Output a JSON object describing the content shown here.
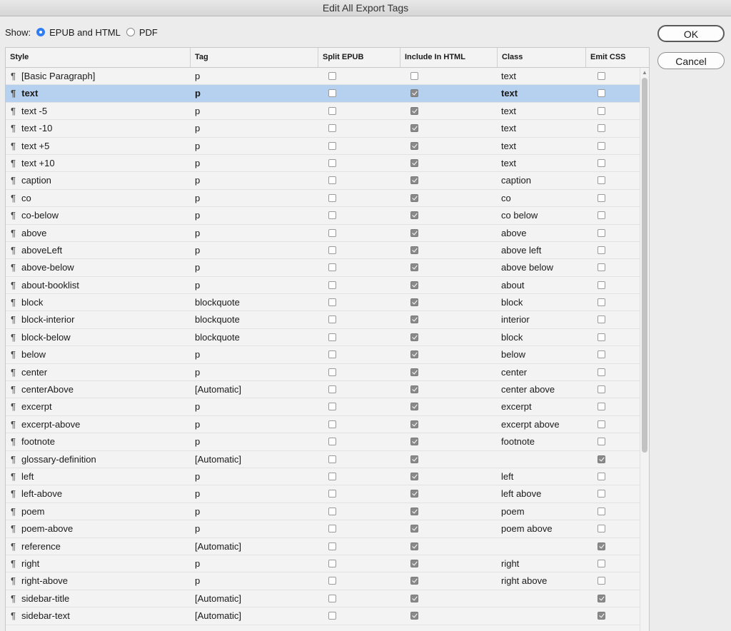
{
  "window": {
    "title": "Edit All Export Tags"
  },
  "show": {
    "label": "Show:",
    "options": [
      {
        "label": "EPUB and HTML",
        "selected": true
      },
      {
        "label": "PDF",
        "selected": false
      }
    ]
  },
  "buttons": {
    "ok": "OK",
    "cancel": "Cancel"
  },
  "table": {
    "headers": {
      "style": "Style",
      "tag": "Tag",
      "split": "Split EPUB",
      "include": "Include In HTML",
      "class": "Class",
      "css": "Emit CSS"
    },
    "paragraph_mark": "¶",
    "selected_row": 1,
    "rows": [
      {
        "style": "[Basic Paragraph]",
        "tag": "p",
        "split": false,
        "include": false,
        "class": "text",
        "css": false
      },
      {
        "style": "text",
        "tag": "p",
        "split": false,
        "include": true,
        "class": "text",
        "css": false
      },
      {
        "style": "text -5",
        "tag": "p",
        "split": false,
        "include": true,
        "class": "text",
        "css": false
      },
      {
        "style": "text -10",
        "tag": "p",
        "split": false,
        "include": true,
        "class": "text",
        "css": false
      },
      {
        "style": "text +5",
        "tag": "p",
        "split": false,
        "include": true,
        "class": "text",
        "css": false
      },
      {
        "style": "text +10",
        "tag": "p",
        "split": false,
        "include": true,
        "class": "text",
        "css": false
      },
      {
        "style": "caption",
        "tag": "p",
        "split": false,
        "include": true,
        "class": "caption",
        "css": false
      },
      {
        "style": "co",
        "tag": "p",
        "split": false,
        "include": true,
        "class": "co",
        "css": false
      },
      {
        "style": "co-below",
        "tag": "p",
        "split": false,
        "include": true,
        "class": "co below",
        "css": false
      },
      {
        "style": "above",
        "tag": "p",
        "split": false,
        "include": true,
        "class": "above",
        "css": false
      },
      {
        "style": "aboveLeft",
        "tag": "p",
        "split": false,
        "include": true,
        "class": "above left",
        "css": false
      },
      {
        "style": "above-below",
        "tag": "p",
        "split": false,
        "include": true,
        "class": "above below",
        "css": false
      },
      {
        "style": "about-booklist",
        "tag": "p",
        "split": false,
        "include": true,
        "class": "about",
        "css": false
      },
      {
        "style": "block",
        "tag": "blockquote",
        "split": false,
        "include": true,
        "class": "block",
        "css": false
      },
      {
        "style": "block-interior",
        "tag": "blockquote",
        "split": false,
        "include": true,
        "class": "interior",
        "css": false
      },
      {
        "style": "block-below",
        "tag": "blockquote",
        "split": false,
        "include": true,
        "class": "block",
        "css": false
      },
      {
        "style": "below",
        "tag": "p",
        "split": false,
        "include": true,
        "class": "below",
        "css": false
      },
      {
        "style": "center",
        "tag": "p",
        "split": false,
        "include": true,
        "class": "center",
        "css": false
      },
      {
        "style": "centerAbove",
        "tag": "[Automatic]",
        "split": false,
        "include": true,
        "class": "center above",
        "css": false
      },
      {
        "style": "excerpt",
        "tag": "p",
        "split": false,
        "include": true,
        "class": "excerpt",
        "css": false
      },
      {
        "style": "excerpt-above",
        "tag": "p",
        "split": false,
        "include": true,
        "class": "excerpt above",
        "css": false
      },
      {
        "style": "footnote",
        "tag": "p",
        "split": false,
        "include": true,
        "class": "footnote",
        "css": false
      },
      {
        "style": "glossary-definition",
        "tag": "[Automatic]",
        "split": false,
        "include": true,
        "class": "",
        "css": true
      },
      {
        "style": "left",
        "tag": "p",
        "split": false,
        "include": true,
        "class": "left",
        "css": false
      },
      {
        "style": "left-above",
        "tag": "p",
        "split": false,
        "include": true,
        "class": "left above",
        "css": false
      },
      {
        "style": "poem",
        "tag": "p",
        "split": false,
        "include": true,
        "class": "poem",
        "css": false
      },
      {
        "style": "poem-above",
        "tag": "p",
        "split": false,
        "include": true,
        "class": "poem above",
        "css": false
      },
      {
        "style": "reference",
        "tag": "[Automatic]",
        "split": false,
        "include": true,
        "class": "",
        "css": true
      },
      {
        "style": "right",
        "tag": "p",
        "split": false,
        "include": true,
        "class": "right",
        "css": false
      },
      {
        "style": "right-above",
        "tag": "p",
        "split": false,
        "include": true,
        "class": "right above",
        "css": false
      },
      {
        "style": "sidebar-title",
        "tag": "[Automatic]",
        "split": false,
        "include": true,
        "class": "",
        "css": true
      },
      {
        "style": "sidebar-text",
        "tag": "[Automatic]",
        "split": false,
        "include": true,
        "class": "",
        "css": true
      }
    ]
  }
}
